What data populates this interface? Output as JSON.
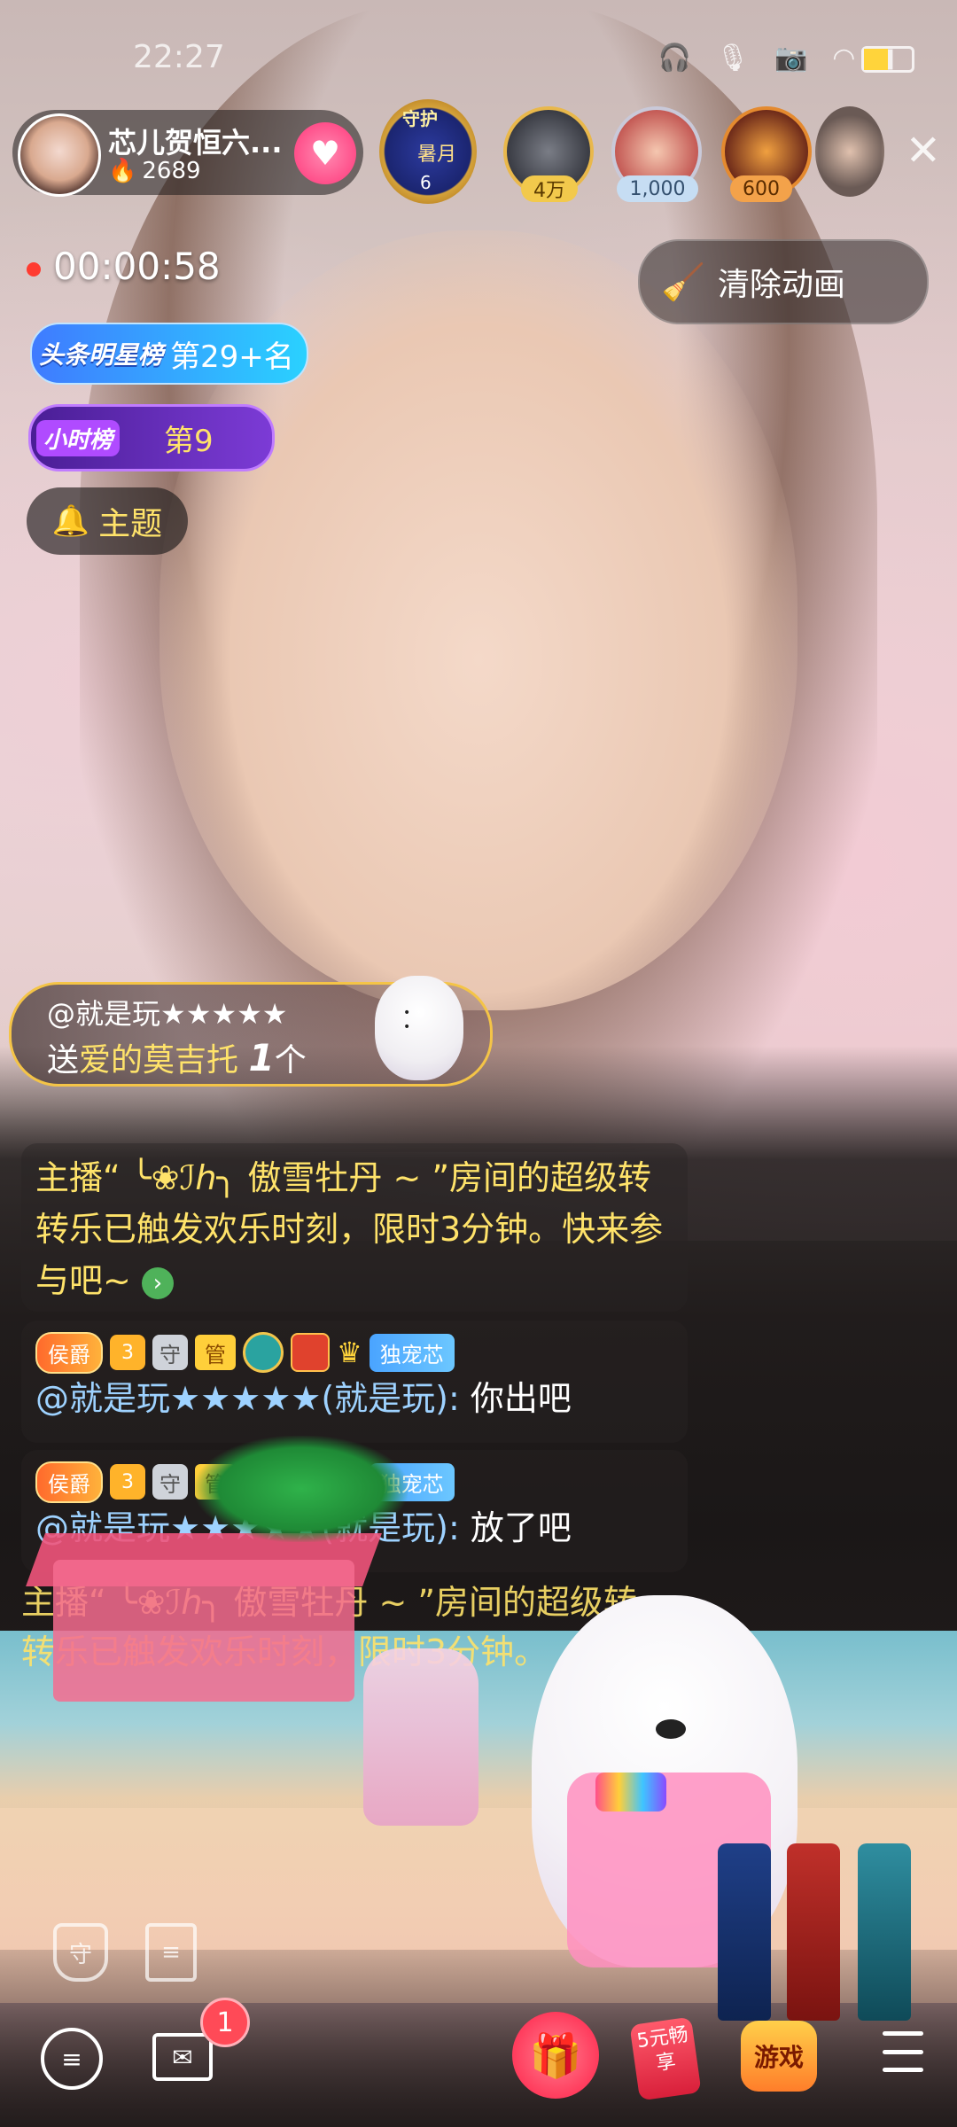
{
  "status_bar": {
    "time": "22:27"
  },
  "host": {
    "name": "芯儿贺恒六...",
    "popularity": "2689"
  },
  "guard_badge": {
    "label": "守护",
    "month": "暑月",
    "count": "6"
  },
  "top_viewers": [
    {
      "value": "4万"
    },
    {
      "value": "1,000"
    },
    {
      "value": "600"
    }
  ],
  "timer": "00:00:58",
  "clear_animation_label": "清除动画",
  "ranks": {
    "headline_tag": "头条明星榜",
    "headline_value": "第29+名",
    "hourly_tag": "小时榜",
    "hourly_value": "第9"
  },
  "topic_label": "主题",
  "gift_banner": {
    "user": "@就是玩★★★★★",
    "prefix": "送",
    "gift_name": "爱的莫吉托",
    "count": "1",
    "unit": "个"
  },
  "chat": {
    "system_message": "主播“ ╰❀ℐℎ╮ 傲雪牡丹 ~ ”房间的超级转转乐已触发欢乐时刻，限时3分钟。快来参与吧~",
    "messages": [
      {
        "badge_rank": "侯爵",
        "badge_level": "3",
        "badge_guard": "守",
        "badge_admin": "管",
        "badge_fan": "独宠芯",
        "user": "@就是玩★★★★★(就是玩):",
        "text": "你出吧"
      },
      {
        "badge_rank": "侯爵",
        "badge_level": "3",
        "badge_guard": "守",
        "badge_admin": "管",
        "badge_fan": "独宠芯",
        "user": "@就是玩★★★★★(就是玩):",
        "text": "放了吧"
      }
    ],
    "system_message_2": "主播“ ╰❀ℐℎ╮ 傲雪牡丹 ~ ”房间的超级转转乐已触发欢乐时刻，限时3分钟。"
  },
  "toolbar": {
    "mail_badge": "1",
    "offer_label": "5元畅享",
    "game_label": "游戏"
  },
  "colors": {
    "accent_yellow": "#ffe36a",
    "user_blue": "#9ed2ff",
    "gift_red": "#ff3b5c"
  }
}
